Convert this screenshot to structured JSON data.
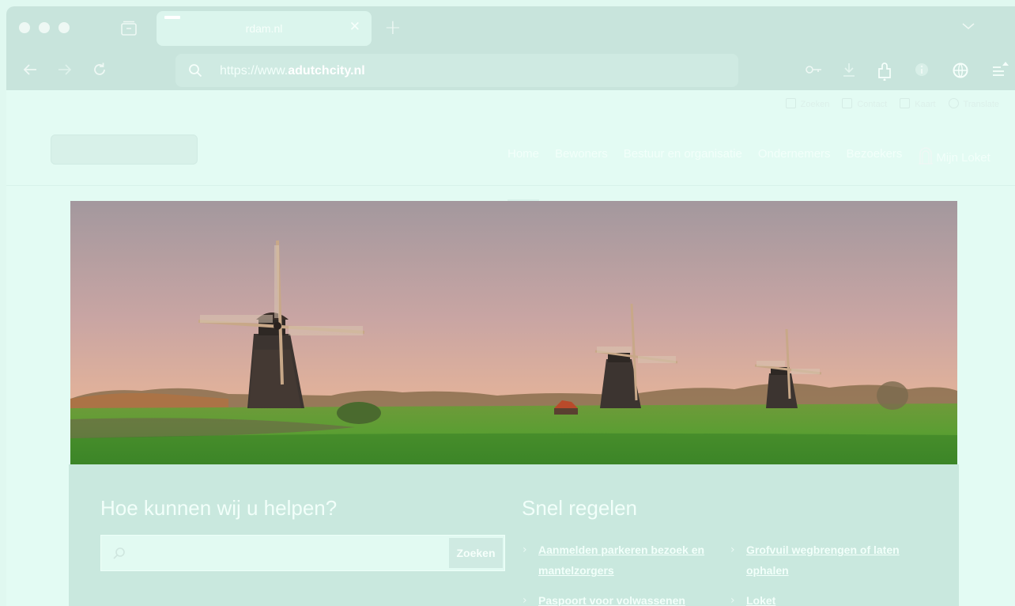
{
  "browser": {
    "tab_title": "rdam.nl",
    "url_prefix": "https://www.",
    "url_domain": "adutchcity.nl"
  },
  "utility_nav": [
    {
      "label": "Zoeken",
      "icon": "search-icon"
    },
    {
      "label": "Contact",
      "icon": "phone-icon"
    },
    {
      "label": "Kaart",
      "icon": "map-icon"
    },
    {
      "label": "Translate",
      "icon": "globe-icon"
    }
  ],
  "main_nav": {
    "items": [
      "Home",
      "Bewoners",
      "Bestuur en organisatie",
      "Ondernemers",
      "Bezoekers"
    ],
    "loket": "Mijn Loket"
  },
  "help": {
    "title": "Hoe kunnen wij u helpen?",
    "search_placeholder": "",
    "search_button": "Zoeken"
  },
  "snel": {
    "title": "Snel regelen",
    "links": [
      {
        "line1": "Aanmelden parkeren bezoek en",
        "line2": "mantelzorgers"
      },
      {
        "line1": "Grofvuil wegbrengen of laten",
        "line2": "ophalen"
      },
      {
        "line1": "Paspoort voor volwassenen",
        "line2": ""
      },
      {
        "line1": "Loket",
        "line2": ""
      }
    ]
  },
  "colors": {
    "page_bg": "#e3fbf3",
    "chrome_bg": "#c8e4dc",
    "panel_bg": "#c9e8de"
  }
}
